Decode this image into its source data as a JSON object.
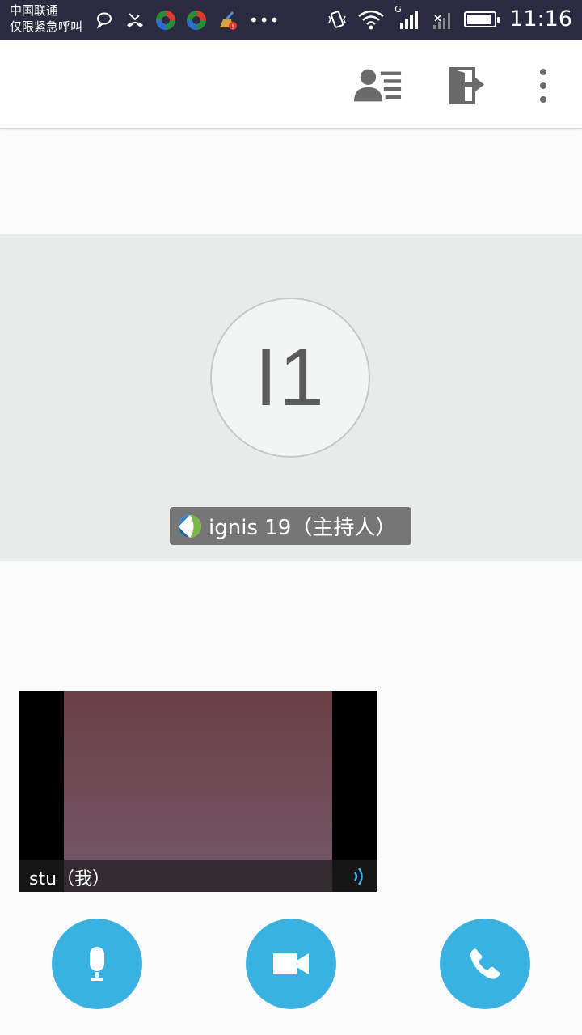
{
  "status_bar": {
    "carrier_line1": "中国联通",
    "carrier_line2": "仅限紧急呼叫",
    "network_type": "G",
    "time": "11:16",
    "battery_level": 0.9,
    "icons": [
      "chat-bubble-icon",
      "missed-call-icon",
      "app-icon",
      "app-icon",
      "cleaner-icon",
      "more-notifications-icon",
      "vibrate-icon",
      "wifi-icon",
      "signal-icon",
      "no-signal-icon",
      "battery-icon"
    ]
  },
  "action_bar": {
    "icons": [
      "participants-list-icon",
      "exit-meeting-icon",
      "overflow-menu-icon"
    ]
  },
  "host": {
    "initials": "I1",
    "label": "ignis 19（主持人）"
  },
  "self_video": {
    "label": "stu（我）"
  },
  "controls": {
    "icons": [
      "microphone-icon",
      "video-camera-icon",
      "phone-icon"
    ]
  },
  "colors": {
    "accent": "#39b1e1",
    "status_bar": "#2a2a40",
    "host_area": "#e9eaea",
    "host_label_bg": "#767676"
  }
}
